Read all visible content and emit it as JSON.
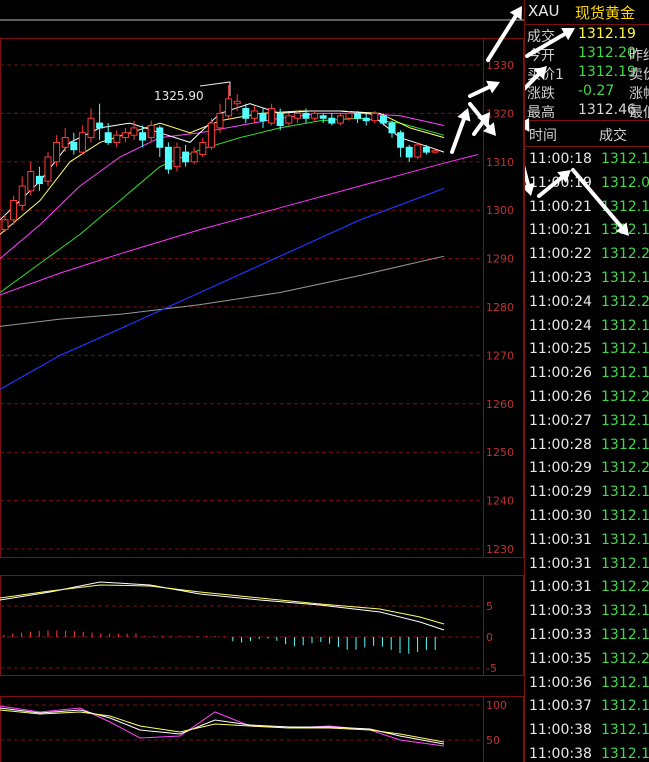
{
  "instrument": {
    "symbol": "XAU",
    "name": "现货黄金"
  },
  "quote": [
    {
      "label": "成交",
      "value": "1312.19",
      "color": "yellow",
      "right_label": ""
    },
    {
      "label": "今开",
      "value": "1312.20",
      "color": "green",
      "right_label": "昨结"
    },
    {
      "label": "买价1",
      "value": "1312.19",
      "color": "green",
      "right_label": "卖价"
    },
    {
      "label": "涨跌",
      "value": "-0.27",
      "color": "green",
      "right_label": "涨幅"
    },
    {
      "label": "最高",
      "value": "1312.46",
      "color": "white",
      "right_label": "最低"
    }
  ],
  "ticks": {
    "header_time": "时间",
    "header_price": "成交",
    "rows": [
      {
        "time": "11:00:18",
        "price": "1312.1"
      },
      {
        "time": "11:00:19",
        "price": "1312.0"
      },
      {
        "time": "11:00:21",
        "price": "1312.1"
      },
      {
        "time": "11:00:21",
        "price": "1312.1"
      },
      {
        "time": "11:00:22",
        "price": "1312.2"
      },
      {
        "time": "11:00:23",
        "price": "1312.1"
      },
      {
        "time": "11:00:24",
        "price": "1312.2"
      },
      {
        "time": "11:00:24",
        "price": "1312.1"
      },
      {
        "time": "11:00:25",
        "price": "1312.1"
      },
      {
        "time": "11:00:26",
        "price": "1312.1"
      },
      {
        "time": "11:00:26",
        "price": "1312.2"
      },
      {
        "time": "11:00:27",
        "price": "1312.1"
      },
      {
        "time": "11:00:28",
        "price": "1312.1"
      },
      {
        "time": "11:00:29",
        "price": "1312.2"
      },
      {
        "time": "11:00:29",
        "price": "1312.1"
      },
      {
        "time": "11:00:30",
        "price": "1312.1"
      },
      {
        "time": "11:00:31",
        "price": "1312.1"
      },
      {
        "time": "11:00:31",
        "price": "1312.1"
      },
      {
        "time": "11:00:31",
        "price": "1312.2"
      },
      {
        "time": "11:00:33",
        "price": "1312.1"
      },
      {
        "time": "11:00:33",
        "price": "1312.1"
      },
      {
        "time": "11:00:35",
        "price": "1312.2"
      },
      {
        "time": "11:00:36",
        "price": "1312.1"
      },
      {
        "time": "11:00:37",
        "price": "1312.1"
      },
      {
        "time": "11:00:38",
        "price": "1312.1"
      },
      {
        "time": "11:00:38",
        "price": "1312.1"
      }
    ]
  },
  "price_chart": {
    "y_ticks": [
      "1330",
      "1320",
      "1310",
      "1300",
      "1290",
      "1280",
      "1270",
      "1260",
      "1250",
      "1240",
      "1230"
    ],
    "peak_label": "1325.90",
    "ylim": [
      1228,
      1336
    ]
  },
  "macd_chart": {
    "y_ticks": [
      "5",
      "0",
      "-5"
    ]
  },
  "kdj_chart": {
    "y_ticks": [
      "100",
      "50"
    ]
  },
  "colors": {
    "up": "#ff3a3a",
    "down": "#54ffff",
    "ma5": "#ffffff",
    "ma10": "#ffff66",
    "ma20": "#ff44ff",
    "ma30": "#33dd33",
    "ma60": "#ff33ff",
    "ma120": "#2233ff",
    "ma250": "#999999",
    "grid": "#7a1010"
  }
}
